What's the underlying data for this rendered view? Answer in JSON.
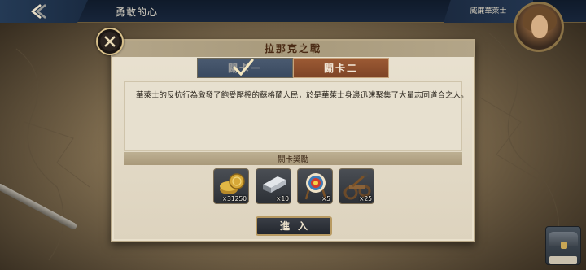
{
  "header": {
    "title": "勇敢的心",
    "player_name": "威廉華萊士"
  },
  "dialog": {
    "title": "拉那克之戰",
    "tabs": [
      {
        "label": "關卡一",
        "completed": true
      },
      {
        "label": "關卡二",
        "selected": true
      }
    ],
    "description": "華萊士的反抗行為激發了飽受壓榨的蘇格蘭人民，於是華萊士身邊迅速聚集了大量志同道合之人。",
    "reward_title": "關卡獎勵",
    "rewards": [
      {
        "icon": "gold-coins-icon",
        "quantity": "×31250"
      },
      {
        "icon": "silver-ingot-icon",
        "quantity": "×10"
      },
      {
        "icon": "archery-target-icon",
        "quantity": "×5"
      },
      {
        "icon": "catapult-siege-icon",
        "quantity": "×25"
      }
    ],
    "enter_label": "進入"
  },
  "colors": {
    "accent_gold": "#b89a62",
    "tab_selected": "#8a4c2c",
    "tab_done": "#43536a"
  }
}
